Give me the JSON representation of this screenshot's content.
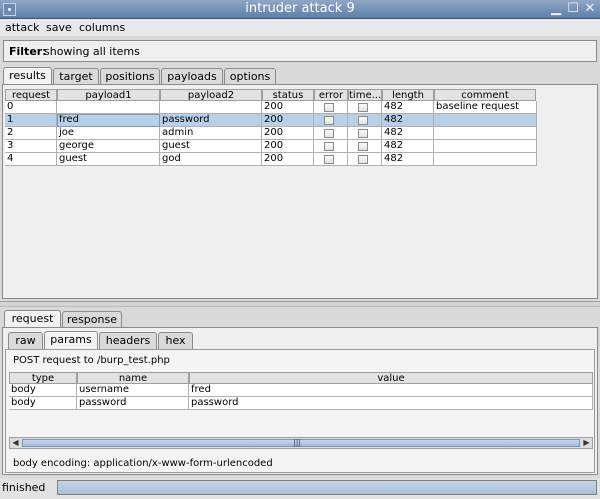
{
  "window": {
    "title": "intruder attack 9"
  },
  "menu": [
    "attack",
    "save",
    "columns"
  ],
  "filter": {
    "label": "Filter:",
    "value": "showing all items"
  },
  "main_tabs": [
    "results",
    "target",
    "positions",
    "payloads",
    "options"
  ],
  "results": {
    "headers": [
      "request",
      "payload1",
      "payload2",
      "status",
      "error",
      "time...",
      "length",
      "comment"
    ],
    "rows": [
      {
        "request": "0",
        "payload1": "",
        "payload2": "",
        "status": "200",
        "error": false,
        "timeout": false,
        "length": "482",
        "comment": "baseline request"
      },
      {
        "request": "1",
        "payload1": "fred",
        "payload2": "password",
        "status": "200",
        "error": false,
        "timeout": false,
        "length": "482",
        "comment": ""
      },
      {
        "request": "2",
        "payload1": "joe",
        "payload2": "admin",
        "status": "200",
        "error": false,
        "timeout": false,
        "length": "482",
        "comment": ""
      },
      {
        "request": "3",
        "payload1": "george",
        "payload2": "guest",
        "status": "200",
        "error": false,
        "timeout": false,
        "length": "482",
        "comment": ""
      },
      {
        "request": "4",
        "payload1": "guest",
        "payload2": "god",
        "status": "200",
        "error": false,
        "timeout": false,
        "length": "482",
        "comment": ""
      }
    ],
    "selected_row": 1
  },
  "bottom_tabs": [
    "request",
    "response"
  ],
  "view_tabs": [
    "raw",
    "params",
    "headers",
    "hex"
  ],
  "params": {
    "description": "POST request to /burp_test.php",
    "headers": [
      "type",
      "name",
      "value"
    ],
    "rows": [
      {
        "type": "body",
        "name": "username",
        "value": "fred"
      },
      {
        "type": "body",
        "name": "password",
        "value": "password"
      }
    ],
    "encoding": "body encoding:  application/x-www-form-urlencoded"
  },
  "status": {
    "text": "finished",
    "progress": 1.0
  }
}
